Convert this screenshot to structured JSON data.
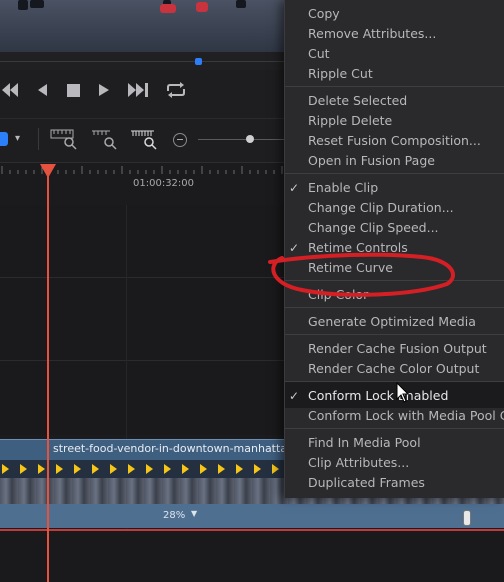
{
  "timeline": {
    "timecode": "01:00:32:00",
    "clip_name": "street-food-vendor-in-downtown-manhatta",
    "speed": "28%"
  },
  "menu": {
    "items": [
      {
        "label": "Copy",
        "checked": false,
        "enabled": true
      },
      {
        "label": "Remove Attributes...",
        "checked": false,
        "enabled": true
      },
      {
        "label": "Cut",
        "checked": false,
        "enabled": true
      },
      {
        "label": "Ripple Cut",
        "checked": false,
        "enabled": true
      },
      {
        "label": "Delete Selected",
        "checked": false,
        "enabled": true
      },
      {
        "label": "Ripple Delete",
        "checked": false,
        "enabled": true
      },
      {
        "label": "Reset Fusion Composition...",
        "checked": false,
        "enabled": true
      },
      {
        "label": "Open in Fusion Page",
        "checked": false,
        "enabled": true
      },
      {
        "label": "Enable Clip",
        "checked": true,
        "enabled": true
      },
      {
        "label": "Change Clip Duration...",
        "checked": false,
        "enabled": true
      },
      {
        "label": "Change Clip Speed...",
        "checked": false,
        "enabled": true
      },
      {
        "label": "Retime Controls",
        "checked": true,
        "enabled": true
      },
      {
        "label": "Retime Curve",
        "checked": false,
        "enabled": true
      },
      {
        "label": "Clip Color",
        "checked": false,
        "enabled": true
      },
      {
        "label": "Generate Optimized Media",
        "checked": false,
        "enabled": true
      },
      {
        "label": "Render Cache Fusion Output",
        "checked": false,
        "enabled": true
      },
      {
        "label": "Render Cache Color Output",
        "checked": false,
        "enabled": true
      },
      {
        "label": "Conform Lock Enabled",
        "checked": true,
        "enabled": true
      },
      {
        "label": "Conform Lock with Media Pool Cl",
        "checked": false,
        "enabled": true
      },
      {
        "label": "Find In Media Pool",
        "checked": false,
        "enabled": true
      },
      {
        "label": "Clip Attributes...",
        "checked": false,
        "enabled": true
      },
      {
        "label": "Duplicated Frames",
        "checked": false,
        "enabled": true
      }
    ]
  },
  "colors": {
    "playhead": "#e5533f",
    "keyframe": "#f5c518",
    "annotation": "#d41f25",
    "clip": "#3f5f80"
  }
}
